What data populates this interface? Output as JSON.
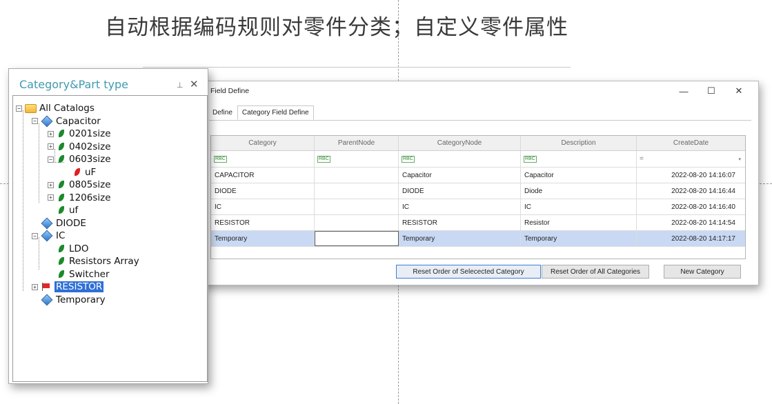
{
  "headline": "自动根据编码规则对零件分类；自定义零件属性",
  "panel": {
    "title": "Category&Part type",
    "pin": "⊥",
    "close": "✕"
  },
  "tree": [
    {
      "label": "All Catalogs",
      "icon": "folder-icon",
      "expander": "−"
    },
    {
      "label": "Capacitor",
      "icon": "diamond-icon",
      "expander": "−"
    },
    {
      "label": "0201size",
      "icon": "leaf-icon",
      "expander": "+"
    },
    {
      "label": "0402size",
      "icon": "leaf-icon",
      "expander": "+"
    },
    {
      "label": "0603size",
      "icon": "leaf-icon",
      "expander": "−"
    },
    {
      "label": "uF",
      "icon": "red-leaf-icon"
    },
    {
      "label": "0805size",
      "icon": "leaf-icon",
      "expander": "+"
    },
    {
      "label": "1206size",
      "icon": "leaf-icon",
      "expander": "+"
    },
    {
      "label": "uf",
      "icon": "leaf-icon"
    },
    {
      "label": "DIODE",
      "icon": "diamond-icon"
    },
    {
      "label": "IC",
      "icon": "diamond-icon",
      "expander": "−"
    },
    {
      "label": "LDO",
      "icon": "leaf-icon"
    },
    {
      "label": "Resistors Array",
      "icon": "leaf-icon"
    },
    {
      "label": "Switcher",
      "icon": "leaf-icon"
    },
    {
      "label": "RESISTOR",
      "icon": "red-flag-icon",
      "expander": "+"
    },
    {
      "label": "Temporary",
      "icon": "diamond-icon"
    }
  ],
  "window": {
    "title": "Field Define",
    "minimize": "—",
    "maximize": "☐",
    "close": "✕"
  },
  "tabs": [
    {
      "label": "Define"
    },
    {
      "label": "Category Field Define"
    }
  ],
  "grid": {
    "columns": [
      "Category",
      "ParentNode",
      "CategoryNode",
      "Description",
      "CreateDate"
    ],
    "filter_icons": [
      "rbc-icon",
      "rbc-icon",
      "rbc-icon",
      "rbc-icon",
      "equals-icon"
    ],
    "filter_symbol": "RBC",
    "equals_symbol": "=",
    "dropdown_symbol": "▾",
    "rows": [
      {
        "category": "CAPACITOR",
        "parent": "",
        "node": "Capacitor",
        "description": "Capacitor",
        "date": "2022-08-20 14:16:07"
      },
      {
        "category": "DIODE",
        "parent": "",
        "node": "DIODE",
        "description": "Diode",
        "date": "2022-08-20 14:16:44"
      },
      {
        "category": "IC",
        "parent": "",
        "node": "IC",
        "description": "IC",
        "date": "2022-08-20 14:16:40"
      },
      {
        "category": "RESISTOR",
        "parent": "",
        "node": "RESISTOR",
        "description": "Resistor",
        "date": "2022-08-20 14:14:54"
      },
      {
        "category": "Temporary",
        "parent": "",
        "node": "Temporary",
        "description": "Temporary",
        "date": "2022-08-20 14:17:17"
      }
    ]
  },
  "buttons": {
    "reset_selected": "Reset Order of Selecected Category",
    "reset_all": "Reset Order of All Categories",
    "new_category": "New Category"
  }
}
